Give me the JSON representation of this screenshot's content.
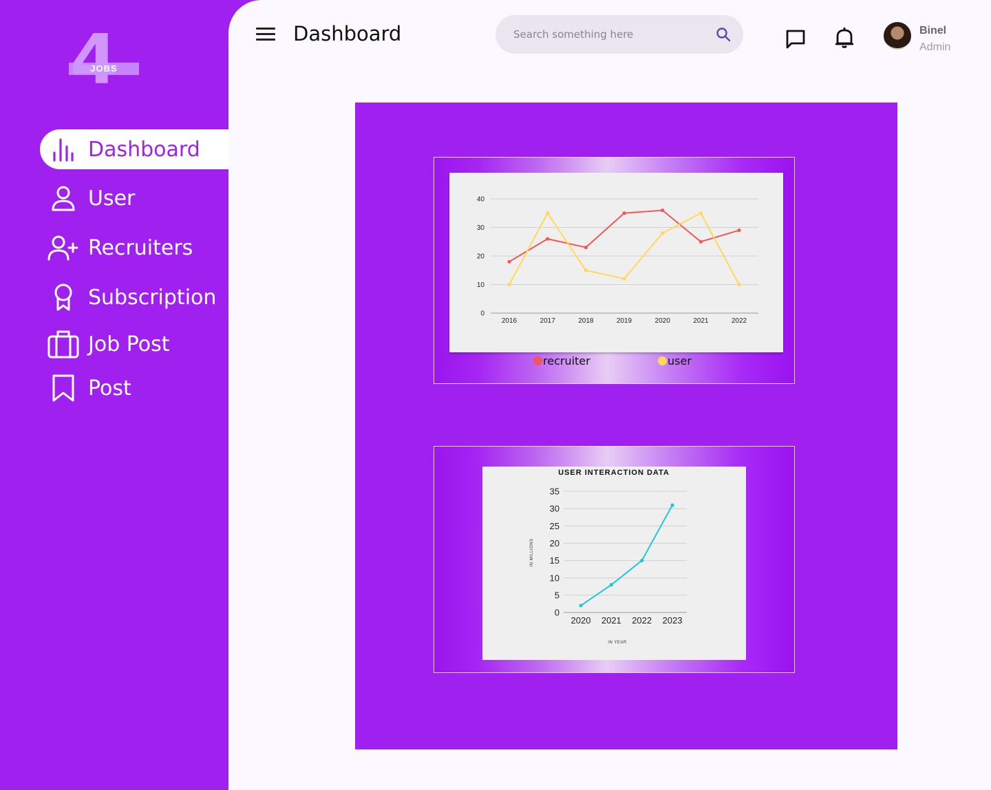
{
  "logo": {
    "number": "4",
    "text": "JOBS"
  },
  "sidebar": {
    "items": [
      {
        "label": "Dashboard",
        "icon": "bar-chart-icon",
        "active": true
      },
      {
        "label": "User",
        "icon": "user-icon"
      },
      {
        "label": "Recruiters",
        "icon": "user-plus-icon"
      },
      {
        "label": "Subscription",
        "icon": "award-icon"
      },
      {
        "label": "Job Post",
        "icon": "briefcase-icon"
      },
      {
        "label": "Post",
        "icon": "bookmark-icon"
      }
    ]
  },
  "header": {
    "title": "Dashboard",
    "search_placeholder": "Search something here",
    "user_name": "Binel",
    "user_role": "Admin"
  },
  "colors": {
    "sidebar_bg": "#a020f0",
    "active_text": "#9b24e8",
    "main_bg": "#fbf8ff",
    "recruiter_line": "#f25757",
    "user_line": "#ffd956",
    "interaction_line": "#1ec6dc"
  },
  "chart_data": [
    {
      "type": "line",
      "title": "",
      "x": [
        "2016",
        "2017",
        "2018",
        "2019",
        "2020",
        "2021",
        "2022"
      ],
      "ylim": [
        0,
        40
      ],
      "yticks": [
        0,
        10,
        20,
        30,
        40
      ],
      "grid": true,
      "legend_position": "bottom",
      "series": [
        {
          "name": "recruiter",
          "color": "#f25757",
          "values": [
            18,
            26,
            23,
            35,
            36,
            25,
            29
          ]
        },
        {
          "name": "user",
          "color": "#ffd956",
          "values": [
            10,
            35,
            15,
            12,
            28,
            35,
            10
          ]
        }
      ]
    },
    {
      "type": "line",
      "title": "USER INTERACTION DATA",
      "xlabel": "IN YEAR",
      "ylabel": "IN MILLIONS",
      "x": [
        "2020",
        "2021",
        "2022",
        "2023"
      ],
      "ylim": [
        0,
        35
      ],
      "yticks": [
        0,
        5,
        10,
        15,
        20,
        25,
        30,
        35
      ],
      "grid": true,
      "series": [
        {
          "color": "#1ec6dc",
          "values": [
            2,
            8,
            15,
            31
          ]
        }
      ]
    }
  ]
}
